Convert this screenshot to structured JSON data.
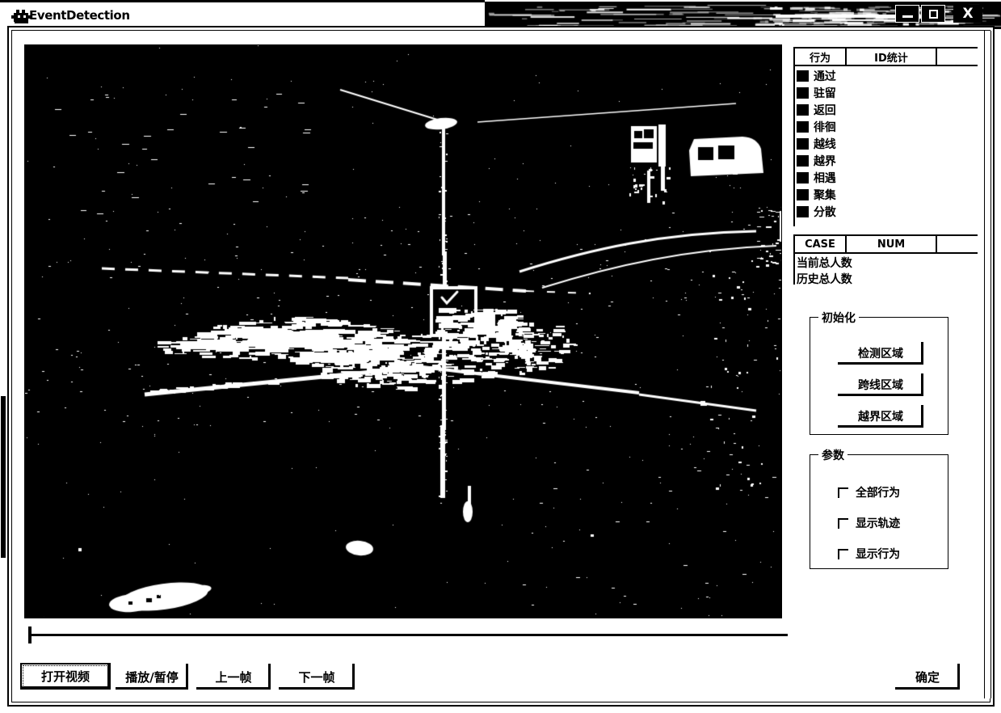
{
  "window": {
    "title": "EventDetection",
    "icon": "app-icon",
    "controls": {
      "minimize": "—",
      "maximize": "□",
      "close": "X"
    }
  },
  "video": {
    "state": "binarized-street-scene",
    "description": "High-contrast black-and-white thresholded surveillance frame of a street intersection with a signboard, a white van and pedestrian blobs"
  },
  "seek": {
    "position": 0,
    "min": 0,
    "max": 100
  },
  "behavior_table": {
    "headers": [
      "行为",
      "ID统计",
      ""
    ],
    "rows": [
      {
        "color": "#000000",
        "label": "通过",
        "count": ""
      },
      {
        "color": "#000000",
        "label": "驻留",
        "count": ""
      },
      {
        "color": "#000000",
        "label": "返回",
        "count": ""
      },
      {
        "color": "#000000",
        "label": "徘徊",
        "count": ""
      },
      {
        "color": "#000000",
        "label": "越线",
        "count": ""
      },
      {
        "color": "#000000",
        "label": "越界",
        "count": ""
      },
      {
        "color": "#000000",
        "label": "相遇",
        "count": ""
      },
      {
        "color": "#000000",
        "label": "聚集",
        "count": ""
      },
      {
        "color": "#000000",
        "label": "分散",
        "count": ""
      }
    ]
  },
  "case_table": {
    "headers": [
      "CASE",
      "NUM",
      ""
    ],
    "rows": [
      {
        "label": "当前总人数",
        "num": ""
      },
      {
        "label": "历史总人数",
        "num": ""
      }
    ]
  },
  "init_group": {
    "title": "初始化",
    "buttons": [
      "检测区域",
      "跨线区域",
      "越界区域"
    ]
  },
  "params_group": {
    "title": "参数",
    "checkboxes": [
      {
        "label": "全部行为",
        "checked": false
      },
      {
        "label": "显示轨迹",
        "checked": false
      },
      {
        "label": "显示行为",
        "checked": false
      }
    ]
  },
  "transport": {
    "open_video": "打开视频",
    "play_pause": "播放/暂停",
    "prev_frame": "上一帧",
    "next_frame": "下一帧"
  },
  "footer": {
    "ok": "确定"
  },
  "colors": {
    "window_bg": "#ffffff",
    "frame": "#000000",
    "video_bg": "#000000",
    "text": "#000000"
  }
}
